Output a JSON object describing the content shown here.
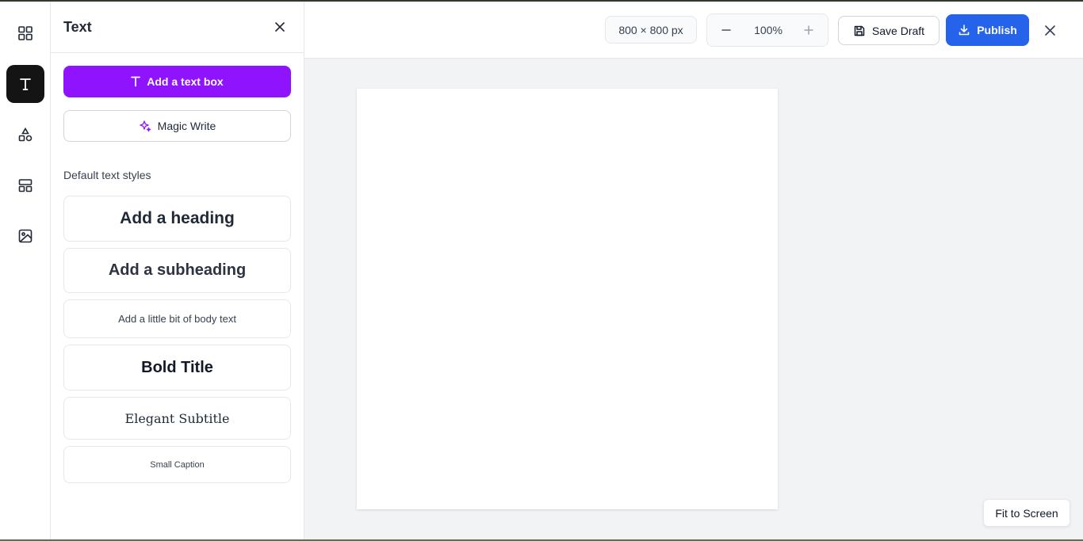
{
  "rail": {
    "items": [
      {
        "icon": "grid-icon",
        "label": "Elements"
      },
      {
        "icon": "text-icon",
        "label": "Text",
        "active": true
      },
      {
        "icon": "shapes-icon",
        "label": "Shapes"
      },
      {
        "icon": "layout-icon",
        "label": "Templates"
      },
      {
        "icon": "image-icon",
        "label": "Images"
      }
    ]
  },
  "panel": {
    "title": "Text",
    "add_text_box": "Add a text box",
    "magic_write": "Magic Write",
    "section_label": "Default text styles",
    "styles": {
      "heading": "Add a heading",
      "subheading": "Add a subheading",
      "body": "Add a little bit of body text",
      "bold_title": "Bold Title",
      "elegant_subtitle": "Elegant Subtitle",
      "small_caption": "Small Caption"
    }
  },
  "toolbar": {
    "canvas_size": "800 × 800 px",
    "zoom_value": "100%",
    "save_draft": "Save Draft",
    "publish": "Publish"
  },
  "canvas": {
    "fit_to_screen": "Fit to Screen"
  },
  "colors": {
    "accent_purple": "#9013fe",
    "publish_blue": "#2563eb",
    "rail_active": "#141414"
  }
}
